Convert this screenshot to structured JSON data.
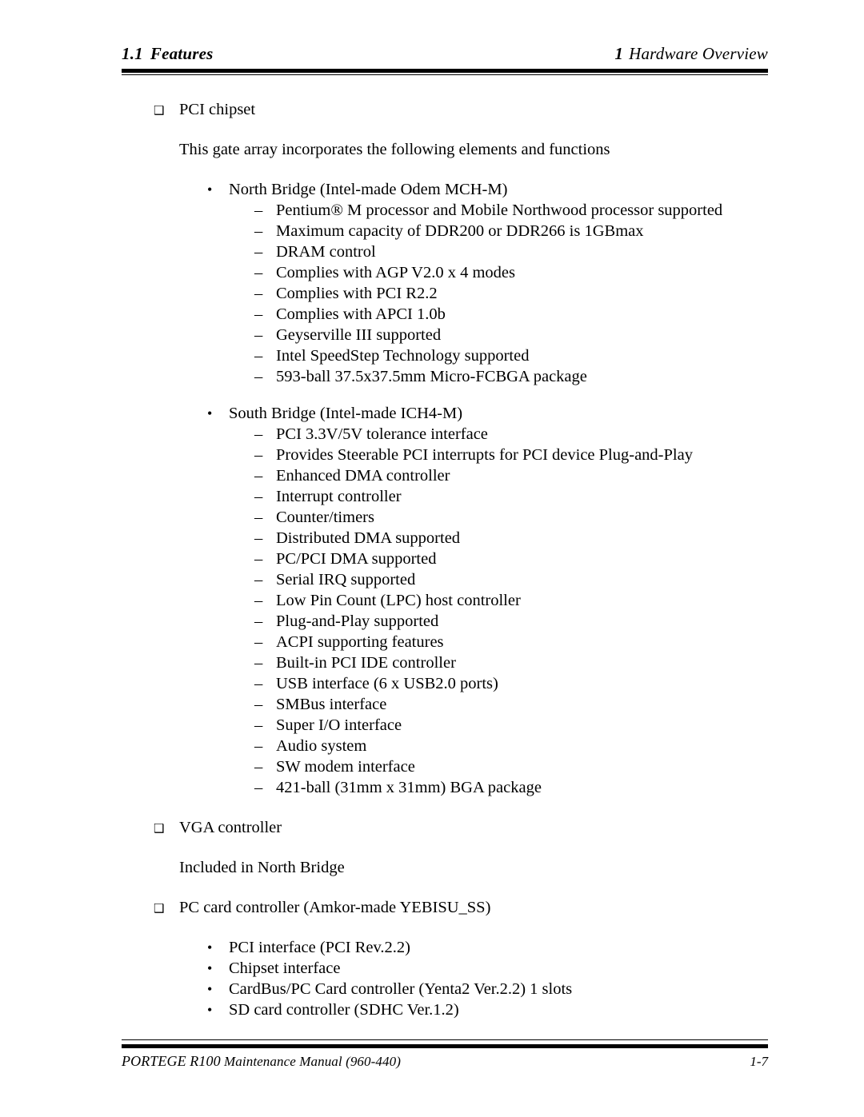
{
  "header": {
    "section_number": "1.1",
    "section_title": "Features",
    "chapter_number": "1",
    "chapter_title": "Hardware Overview"
  },
  "bullets": {
    "square": "❑",
    "round": "•",
    "dash": "–"
  },
  "body": {
    "items": [
      {
        "level": 1,
        "text": "PCI chipset"
      },
      {
        "level": 0,
        "text": "This gate array incorporates the following elements and functions"
      },
      {
        "level": 2,
        "text": "North Bridge (Intel-made Odem MCH-M)"
      },
      {
        "level": 3,
        "text": "Pentium® M processor and Mobile Northwood processor supported"
      },
      {
        "level": 3,
        "text": "Maximum capacity of DDR200 or DDR266 is 1GBmax"
      },
      {
        "level": 3,
        "text": "DRAM control"
      },
      {
        "level": 3,
        "text": "Complies with AGP V2.0 x 4 modes"
      },
      {
        "level": 3,
        "text": "Complies with PCI R2.2"
      },
      {
        "level": 3,
        "text": "Complies with APCI 1.0b"
      },
      {
        "level": 3,
        "text": "Geyserville III supported"
      },
      {
        "level": 3,
        "text": "Intel SpeedStep Technology supported"
      },
      {
        "level": 3,
        "text": "593-ball 37.5x37.5mm Micro-FCBGA package"
      },
      {
        "level": 2,
        "text": "South Bridge (Intel-made ICH4-M)"
      },
      {
        "level": 3,
        "text": "PCI 3.3V/5V tolerance interface"
      },
      {
        "level": 3,
        "text": "Provides Steerable PCI interrupts for PCI device Plug-and-Play"
      },
      {
        "level": 3,
        "text": "Enhanced DMA controller"
      },
      {
        "level": 3,
        "text": "Interrupt controller"
      },
      {
        "level": 3,
        "text": "Counter/timers"
      },
      {
        "level": 3,
        "text": "Distributed DMA supported"
      },
      {
        "level": 3,
        "text": "PC/PCI DMA supported"
      },
      {
        "level": 3,
        "text": "Serial IRQ supported"
      },
      {
        "level": 3,
        "text": "Low Pin Count (LPC) host controller"
      },
      {
        "level": 3,
        "text": "Plug-and-Play supported"
      },
      {
        "level": 3,
        "text": "ACPI supporting features"
      },
      {
        "level": 3,
        "text": "Built-in PCI IDE controller"
      },
      {
        "level": 3,
        "text": "USB interface (6 x USB2.0 ports)"
      },
      {
        "level": 3,
        "text": "SMBus interface"
      },
      {
        "level": 3,
        "text": "Super I/O interface"
      },
      {
        "level": 3,
        "text": "Audio system"
      },
      {
        "level": 3,
        "text": "SW modem interface"
      },
      {
        "level": 3,
        "text": "421-ball (31mm x 31mm) BGA package"
      },
      {
        "level": 1,
        "text": "VGA controller"
      },
      {
        "level": 0,
        "text": "Included in North Bridge"
      },
      {
        "level": 1,
        "text": "PC card controller (Amkor-made YEBISU_SS)"
      },
      {
        "level": 2,
        "text": "PCI interface (PCI Rev.2.2)"
      },
      {
        "level": 2,
        "text": "Chipset interface"
      },
      {
        "level": 2,
        "text": "CardBus/PC Card controller (Yenta2 Ver.2.2) 1 slots"
      },
      {
        "level": 2,
        "text": "SD card controller (SDHC Ver.1.2)"
      }
    ]
  },
  "footer": {
    "manual_brand": "PORTEGE R100",
    "manual_title": "Maintenance Manual (960-440)",
    "page_number": "1-7"
  }
}
